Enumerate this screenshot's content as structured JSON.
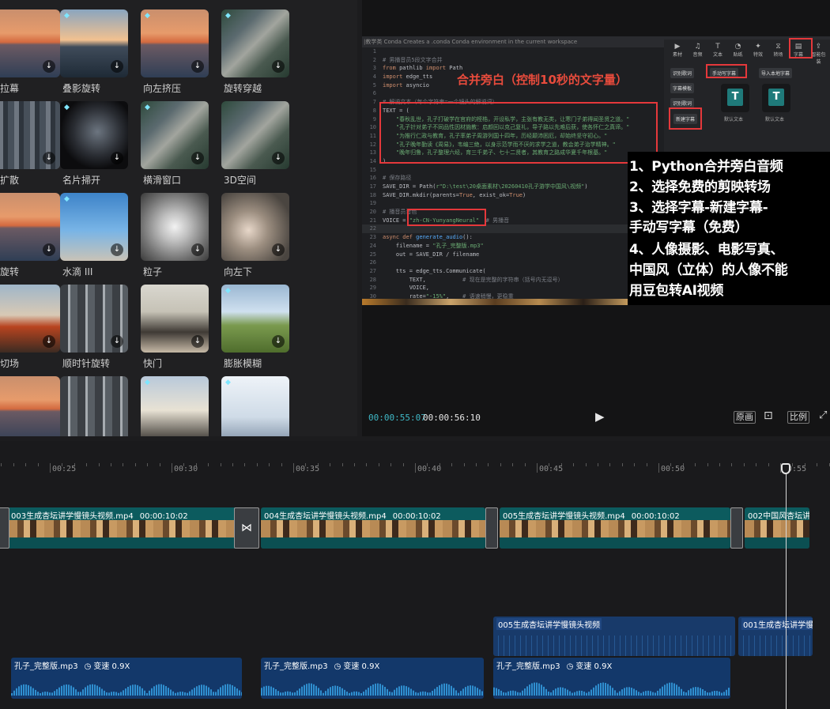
{
  "effects": {
    "tiles": [
      {
        "label": "拉幕",
        "thumb": "g-sunset",
        "gem": false
      },
      {
        "label": "叠影旋转",
        "thumb": "g-sea",
        "gem": true
      },
      {
        "label": "向左挤压",
        "thumb": "g-sunset",
        "gem": true
      },
      {
        "label": "旋转穿越",
        "thumb": "g-aerial",
        "gem": true
      },
      {
        "label": "扩散",
        "thumb": "g-city",
        "gem": false
      },
      {
        "label": "名片掃开",
        "thumb": "g-dark",
        "gem": true
      },
      {
        "label": "横滑窗口",
        "thumb": "g-aerial",
        "gem": true
      },
      {
        "label": "3D空间",
        "thumb": "g-aerial",
        "gem": false
      },
      {
        "label": "旋转",
        "thumb": "g-sunset",
        "gem": false
      },
      {
        "label": "水滴 III",
        "thumb": "g-skate",
        "gem": true
      },
      {
        "label": "粒子",
        "thumb": "g-blur",
        "gem": false
      },
      {
        "label": "向左下",
        "thumb": "g-blur2",
        "gem": false
      },
      {
        "label": "切场",
        "thumb": "g-car",
        "gem": false
      },
      {
        "label": "顺时针旋转",
        "thumb": "g-street",
        "gem": false
      },
      {
        "label": "快门",
        "thumb": "g-woman",
        "gem": false
      },
      {
        "label": "膨胀模糊",
        "thumb": "g-field",
        "gem": true
      },
      {
        "label": "",
        "thumb": "g-sunset",
        "gem": false
      },
      {
        "label": "",
        "thumb": "g-street",
        "gem": false
      },
      {
        "label": "",
        "thumb": "g-dance",
        "gem": true
      },
      {
        "label": "",
        "thumb": "g-tower",
        "gem": true
      }
    ],
    "download_icon": "↓",
    "gem_icon": "◆"
  },
  "preview": {
    "top_strip": "|教学类    Conda  Creates a .conda  Conda environment in the current workspace",
    "code_overlay_title": "合并旁白（控制10秒的文字量）",
    "code_lines": [
      {
        "n": "1",
        "html": ""
      },
      {
        "n": "2",
        "html": "<span class='cm'># 男播音员5段文字合并</span>"
      },
      {
        "n": "3",
        "html": "<span class='kw'>from</span><span class='tx'> pathlib </span><span class='kw'>import</span><span class='tx'> Path</span>"
      },
      {
        "n": "4",
        "html": "<span class='kw'>import</span><span class='tx'> edge_tts</span>"
      },
      {
        "n": "5",
        "html": "<span class='kw'>import</span><span class='tx'> asyncio</span>"
      },
      {
        "n": "6",
        "html": ""
      },
      {
        "n": "7",
        "html": "<span class='cm'># 解说文本（每个字符串=一个镜头的解说词）</span>"
      },
      {
        "n": "8",
        "html": "<span class='tx'>TEXT = (</span>"
      },
      {
        "n": "9",
        "html": "<span class='st'>    \"春秋乱世，孔子打破学在官府的桎梏，开设私学，主张有教无类，让寒门子弟得闻圣贤之道。\"</span>"
      },
      {
        "n": "10",
        "html": "<span class='st'>    \"孔子针对弟子不同品性因材施教：启颜回以克己复礼，导子路以先难后获，使各怀仁之真谛。\"</span>"
      },
      {
        "n": "11",
        "html": "<span class='st'>    \"为推行仁政与教育，孔子率弟子周游列国十四年，历经颠沛困厄，却始终坚守初心。\"</span>"
      },
      {
        "n": "12",
        "html": "<span class='st'>    \"孔子晚年勤读《周易》，韦编三绝，以身示范学而不厌的求学之道，教会弟子治学精神。\"</span>"
      },
      {
        "n": "13",
        "html": "<span class='st'>    \"晚年归鲁，孔子整理六经，育三千弟子、七十二贤者，其教育之路成华夏千年根基。\"</span>"
      },
      {
        "n": "14",
        "html": "<span class='tx'>)</span>"
      },
      {
        "n": "15",
        "html": ""
      },
      {
        "n": "16",
        "html": "<span class='cm'># 保存路径</span>"
      },
      {
        "n": "17",
        "html": "<span class='tx'>SAVE_DIR = Path(</span><span class='st'>r\"D:\\test\\20桌面素材\\20260410孔子游学中国风\\视频\"</span><span class='tx'>)</span>"
      },
      {
        "n": "18",
        "html": "<span class='tx'>SAVE_DIR.mkdir(parents=</span><span class='kw'>True</span><span class='tx'>, exist_ok=</span><span class='kw'>True</span><span class='tx'>)</span>"
      },
      {
        "n": "19",
        "html": ""
      },
      {
        "n": "20",
        "html": "<span class='cm'># 播音员音色</span>"
      },
      {
        "n": "21",
        "html": "<span class='tx'>VOICE = </span><span class='st'>\"zh-CN-YunyangNeural\"</span><span class='cm'>  # 男播音</span>"
      },
      {
        "n": "22",
        "html": ""
      },
      {
        "n": "23",
        "html": "<span class='kw'>async def</span><span class='fn'> generate_audio</span><span class='tx'>():</span>"
      },
      {
        "n": "24",
        "html": "<span class='tx'>    filename = </span><span class='st'>\"孔子_完整版.mp3\"</span>"
      },
      {
        "n": "25",
        "html": "<span class='tx'>    out = SAVE_DIR / filename</span>"
      },
      {
        "n": "26",
        "html": ""
      },
      {
        "n": "27",
        "html": "<span class='tx'>    tts = edge_tts.Communicate(</span>"
      },
      {
        "n": "28",
        "html": "<span class='tx'>        TEXT,           </span><span class='cm'># 现在是完整的字符串（括号内无逗号）</span>"
      },
      {
        "n": "29",
        "html": "<span class='tx'>        VOICE,</span>"
      },
      {
        "n": "30",
        "html": "<span class='tx'>        rate=</span><span class='st'>\"-15%\"</span><span class='tx'>,    </span><span class='cm'># 语速稍慢，更稳重</span>"
      }
    ],
    "side_tabs": [
      {
        "label": "素材",
        "sym": "▶"
      },
      {
        "label": "音频",
        "sym": "♫"
      },
      {
        "label": "文本",
        "sym": "T"
      },
      {
        "label": "贴纸",
        "sym": "◔"
      },
      {
        "label": "特效",
        "sym": "✦"
      },
      {
        "label": "转场",
        "sym": "⧖"
      },
      {
        "label": "字幕",
        "sym": "▤"
      },
      {
        "label": "智能包装",
        "sym": "⇪"
      }
    ],
    "side_buttons": {
      "recognize": "识别歌词",
      "manual": "手动写字幕",
      "import_sub": "导入本地字幕",
      "sub_template": "字幕模板",
      "lyric": "识别歌词",
      "new_sub": "新建字幕"
    },
    "card_captions": [
      "默认文本",
      "默认文本"
    ],
    "notes": [
      "1、Python合并旁白音频",
      "2、选择免费的剪映转场",
      "3、选择字幕-新建字幕-",
      "手动写字幕（免费）",
      "4、人像摄影、电影写真、",
      "中国风（立体）的人像不能",
      "用豆包转AI视频"
    ],
    "current_time": "00:00:55:07",
    "total_time": "00:00:56:10",
    "btn_original": "原画",
    "btn_ratio": "比例"
  },
  "timeline": {
    "ruler": [
      "00:25",
      "00:30",
      "00:35",
      "00:40",
      "00:45",
      "00:50",
      "00:55"
    ],
    "video_clips": [
      {
        "name": "003生成杏坛讲学慢镜头视频.mp4",
        "dur": "00:00:10:02"
      },
      {
        "name": "004生成杏坛讲学慢镜头视频.mp4",
        "dur": "00:00:10:02"
      },
      {
        "name": "005生成杏坛讲学慢镜头视频.mp4",
        "dur": "00:00:10:02"
      },
      {
        "name": "002中国风杏坛讲",
        "dur": ""
      }
    ],
    "sub_clips": [
      "005生成杏坛讲学慢镜头视频",
      "001生成杏坛讲学慢镜"
    ],
    "audio_clips": [
      {
        "name": "孔子_完整版.mp3",
        "speed": "变速 0.9X"
      },
      {
        "name": "孔子_完整版.mp3",
        "speed": "变速 0.9X"
      },
      {
        "name": "孔子_完整版.mp3",
        "speed": "变速 0.9X"
      }
    ],
    "transition_icon": "⋈",
    "speed_icon": "◷"
  },
  "colors": {
    "accent": "#1fa6b5",
    "highlight_red": "#e5383b",
    "video_track": "#0c5b5e",
    "audio_track": "#13386a"
  }
}
